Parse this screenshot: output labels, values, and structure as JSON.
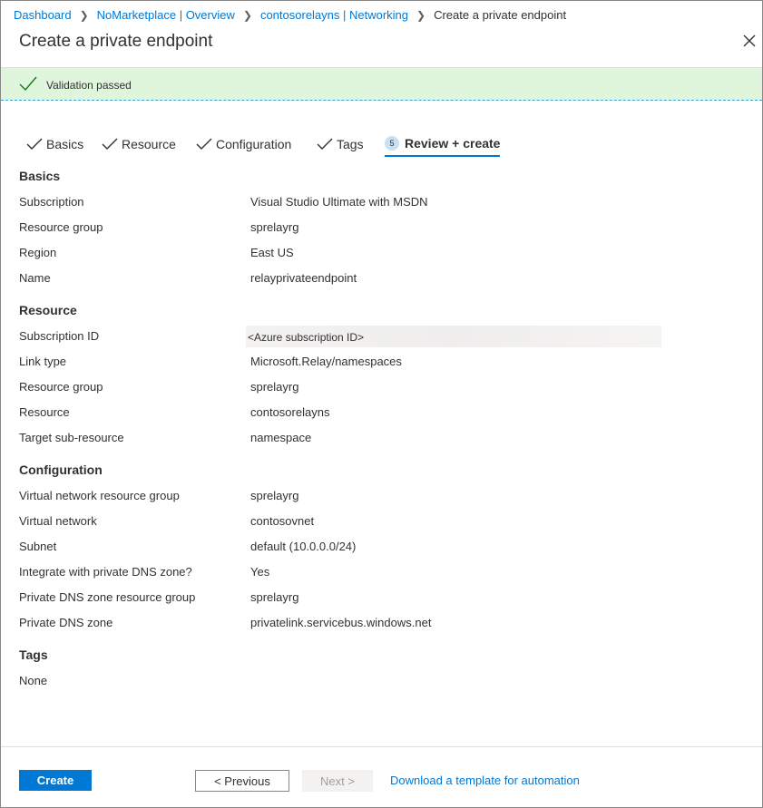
{
  "breadcrumb": {
    "items": [
      "Dashboard",
      "NoMarketplace | Overview",
      "contosorelayns | Networking"
    ],
    "current": "Create a private endpoint"
  },
  "title": "Create a private endpoint",
  "banner": {
    "message": "Validation passed",
    "color": "#dff6dd"
  },
  "tabs": [
    {
      "label": "Basics"
    },
    {
      "label": "Resource"
    },
    {
      "label": "Configuration"
    },
    {
      "label": "Tags"
    },
    {
      "label": "Review + create",
      "step": "5"
    }
  ],
  "sections": {
    "basics": {
      "heading": "Basics",
      "rows": [
        {
          "label": "Subscription",
          "value": "Visual Studio Ultimate with MSDN"
        },
        {
          "label": "Resource group",
          "value": "sprelayrg"
        },
        {
          "label": "Region",
          "value": "East US"
        },
        {
          "label": "Name",
          "value": "relayprivateendpoint"
        }
      ]
    },
    "resource": {
      "heading": "Resource",
      "rows": [
        {
          "label": "Subscription ID",
          "value": "<Azure subscription ID>"
        },
        {
          "label": "Link type",
          "value": "Microsoft.Relay/namespaces"
        },
        {
          "label": "Resource group",
          "value": "sprelayrg"
        },
        {
          "label": "Resource",
          "value": "contosorelayns"
        },
        {
          "label": "Target sub-resource",
          "value": "namespace"
        }
      ]
    },
    "configuration": {
      "heading": "Configuration",
      "rows": [
        {
          "label": "Virtual network resource group",
          "value": "sprelayrg"
        },
        {
          "label": "Virtual network",
          "value": "contosovnet"
        },
        {
          "label": "Subnet",
          "value": "default (10.0.0.0/24)"
        },
        {
          "label": "Integrate with private DNS zone?",
          "value": "Yes"
        },
        {
          "label": "Private DNS zone resource group",
          "value": "sprelayrg"
        },
        {
          "label": "Private DNS zone",
          "value": "privatelink.servicebus.windows.net"
        }
      ]
    },
    "tags": {
      "heading": "Tags",
      "rows": [
        {
          "label": "None"
        }
      ]
    }
  },
  "footer": {
    "create": "Create",
    "previous": "< Previous",
    "next": "Next >",
    "download": "Download a template for automation"
  },
  "colors": {
    "accent": "#0078d4",
    "success": "#107c10"
  },
  "icons": {
    "check": "checkmark-icon",
    "close": "close-icon",
    "chevron": "chevron-right-icon"
  }
}
